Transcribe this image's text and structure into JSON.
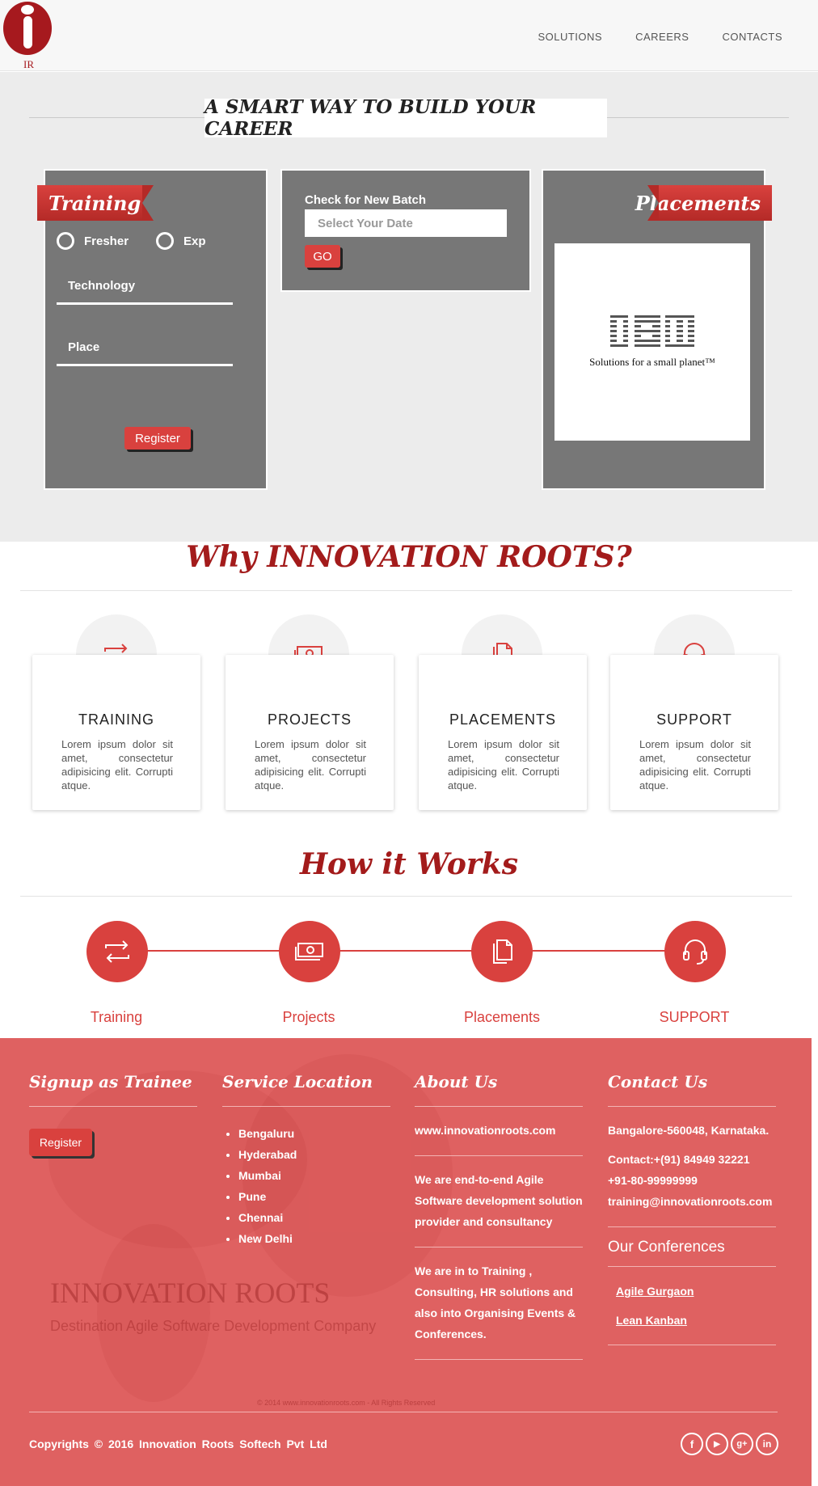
{
  "header": {
    "logo_text": "IR",
    "nav": [
      "SOLUTIONS",
      "CAREERS",
      "CONTACTS"
    ]
  },
  "hero": {
    "title": "A SMART WAY TO BUILD YOUR CAREER",
    "training": {
      "ribbon": "Training",
      "radio_fresher": "Fresher",
      "radio_exp": "Exp",
      "technology": "Technology",
      "place": "Place",
      "register": "Register"
    },
    "batch": {
      "label": "Check for New Batch",
      "placeholder": "Select Your Date",
      "go": "GO"
    },
    "placements": {
      "ribbon": "Placements",
      "company_logo_text": "IBM",
      "company_tagline": "Solutions for a small planet™"
    }
  },
  "why": {
    "title": "Why INNOVATION ROOTS?",
    "cards": [
      {
        "title": "TRAINING",
        "icon": "repeat-icon",
        "body": "Lorem ipsum dolor sit amet, consectetur adipisicing elit. Corrupti atque."
      },
      {
        "title": "PROJECTS",
        "icon": "money-icon",
        "body": "Lorem ipsum dolor sit amet, consectetur adipisicing elit. Corrupti atque."
      },
      {
        "title": "PLACEMENTS",
        "icon": "documents-icon",
        "body": "Lorem ipsum dolor sit amet, consectetur adipisicing elit. Corrupti atque."
      },
      {
        "title": "SUPPORT",
        "icon": "headset-icon",
        "body": "Lorem ipsum dolor sit amet, consectetur adipisicing elit. Corrupti atque."
      }
    ]
  },
  "how": {
    "title": "How it Works",
    "steps": [
      "Training",
      "Projects",
      "Placements",
      "SUPPORT"
    ]
  },
  "footer": {
    "signup": {
      "heading": "Signup as Trainee",
      "register": "Register"
    },
    "locations": {
      "heading": "Service Location",
      "items": [
        "Bengaluru",
        "Hyderabad",
        "Mumbai",
        "Pune",
        "Chennai",
        "New Delhi"
      ]
    },
    "about": {
      "heading": "About Us",
      "website": "www.innovationroots.com",
      "para1": "We are end-to-end Agile Software development solution provider and consultancy",
      "para2": "We are in to Training , Consulting, HR solutions and also into Organising Events & Conferences."
    },
    "contact": {
      "heading": "Contact Us",
      "address": "Bangalore-560048, Karnataka.",
      "phone1": "Contact:+(91) 84949 32221",
      "phone2": "+91-80-99999999",
      "email": "training@innovationroots.com",
      "conferences_heading": "Our Conferences",
      "conferences": [
        "Agile Gurgaon",
        "Lean Kanban"
      ]
    },
    "watermark_title": "INNOVATION ROOTS",
    "watermark_subtitle": "Destination Agile Software Development Company",
    "faint_copyright": "© 2014 www.innovationroots.com - All Rights Reserved",
    "copyright": "Copyrights © 2016 Innovation Roots Softech Pvt Ltd",
    "social": [
      "f",
      "▶",
      "g+",
      "in"
    ]
  },
  "colors": {
    "accent": "#d9413e",
    "heading_red": "#a31b1b",
    "panel_gray": "#777777",
    "footer_bg": "#df6161"
  }
}
